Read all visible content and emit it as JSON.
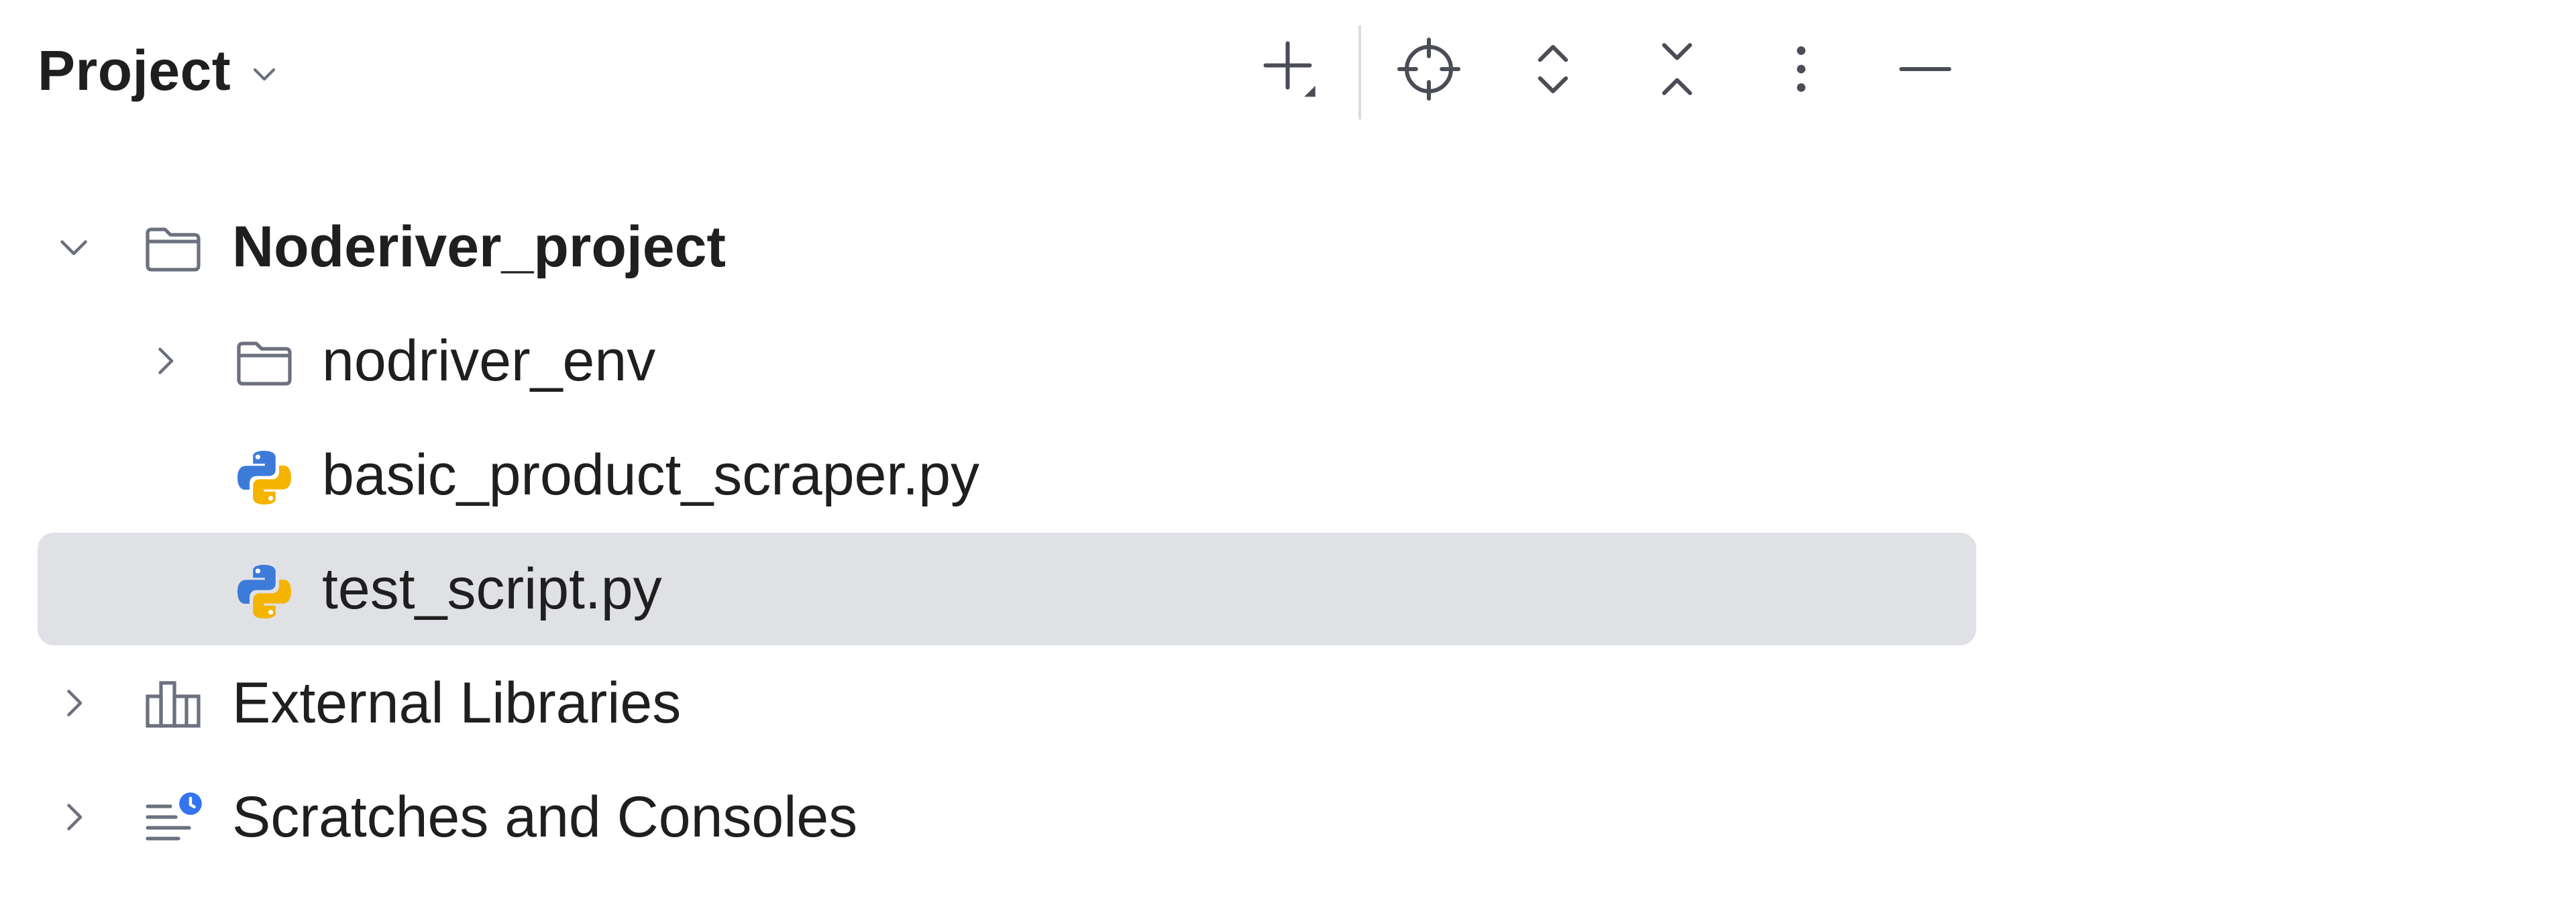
{
  "panel": {
    "title": "Project"
  },
  "toolbar": {
    "buttons": [
      {
        "name": "new-item",
        "icon": "plus-icon"
      },
      {
        "name": "select-opened-file",
        "icon": "locate-icon"
      },
      {
        "name": "expand-all",
        "icon": "expand-all-icon"
      },
      {
        "name": "collapse-all",
        "icon": "collapse-all-icon"
      },
      {
        "name": "options",
        "icon": "kebab-menu-icon"
      },
      {
        "name": "hide",
        "icon": "minimize-icon"
      }
    ]
  },
  "tree": {
    "items": [
      {
        "label": "Noderiver_project",
        "icon": "folder-icon",
        "expanded": true,
        "bold": true,
        "level": 0
      },
      {
        "label": "nodriver_env",
        "icon": "folder-icon",
        "expanded": false,
        "level": 1
      },
      {
        "label": "basic_product_scraper.py",
        "icon": "python-file-icon",
        "level": 1
      },
      {
        "label": "test_script.py",
        "icon": "python-file-icon",
        "level": 1,
        "selected": true
      },
      {
        "label": "External Libraries",
        "icon": "library-icon",
        "expanded": false,
        "level": 0
      },
      {
        "label": "Scratches and Consoles",
        "icon": "scratches-icon",
        "expanded": false,
        "level": 0
      }
    ]
  },
  "colors": {
    "selection": "#dfe1e5",
    "text": "#1f1f1f",
    "icon_gray": "#6c707e",
    "python_blue": "#3d7bd9",
    "python_yellow": "#f5b400",
    "badge_blue": "#3574f0"
  }
}
